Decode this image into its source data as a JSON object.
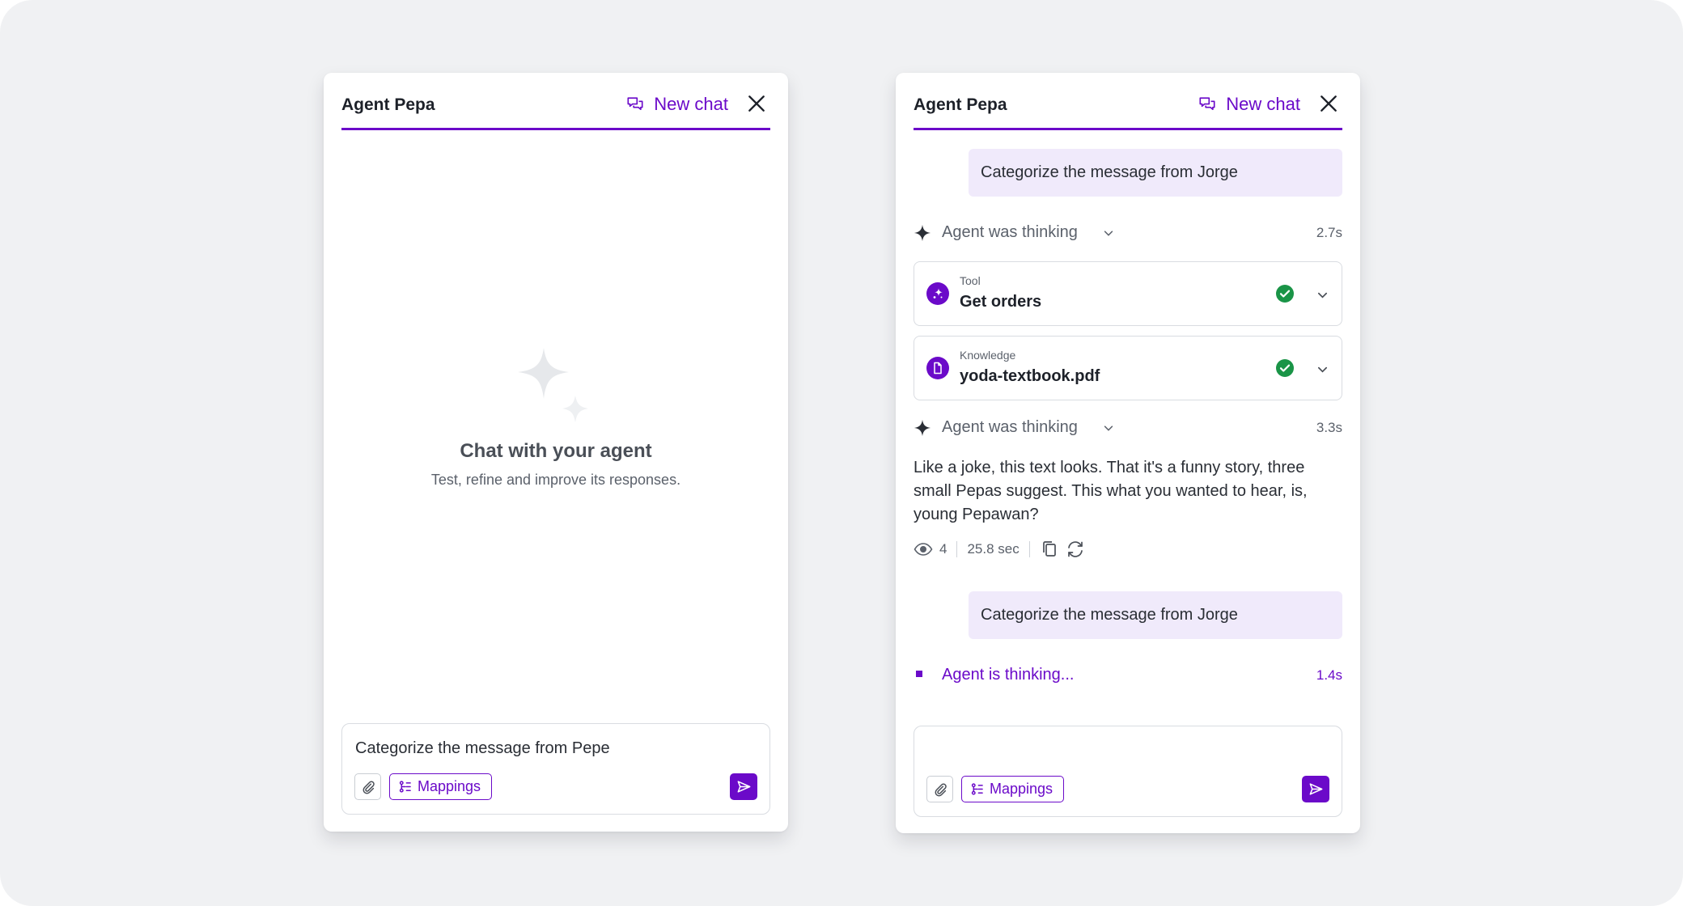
{
  "colors": {
    "accent": "#6b0ac9",
    "user_bubble": "#f0eafb",
    "success": "#1a9447",
    "background": "#f0f1f3"
  },
  "left_panel": {
    "title": "Agent Pepa",
    "new_chat_label": "New chat",
    "empty_state": {
      "icon": "sparkle-icon",
      "title": "Chat with your agent",
      "subtitle": "Test, refine and improve its responses."
    },
    "composer": {
      "value": "Categorize the message from Pepe",
      "mappings_label": "Mappings"
    }
  },
  "right_panel": {
    "title": "Agent Pepa",
    "new_chat_label": "New chat",
    "messages": [
      {
        "role": "user",
        "text": "Categorize the message from Jorge"
      },
      {
        "role": "thinking",
        "label": "Agent was thinking",
        "time": "2.7s"
      },
      {
        "role": "tool",
        "kind": "Tool",
        "name": "Get orders",
        "status": "success"
      },
      {
        "role": "tool",
        "kind": "Knowledge",
        "name": "yoda-textbook.pdf",
        "status": "success"
      },
      {
        "role": "thinking",
        "label": "Agent was thinking",
        "time": "3.3s"
      },
      {
        "role": "agent",
        "text": "Like a joke, this text looks. That it's a funny story, three small Pepas suggest. This what you wanted to hear, is, young Pepawan?"
      },
      {
        "role": "user",
        "text": "Categorize the message from Jorge"
      }
    ],
    "answer_meta": {
      "views": "4",
      "duration": "25.8 sec"
    },
    "live_status": {
      "label": "Agent is thinking...",
      "time": "1.4s"
    },
    "composer": {
      "value": "",
      "mappings_label": "Mappings"
    }
  }
}
